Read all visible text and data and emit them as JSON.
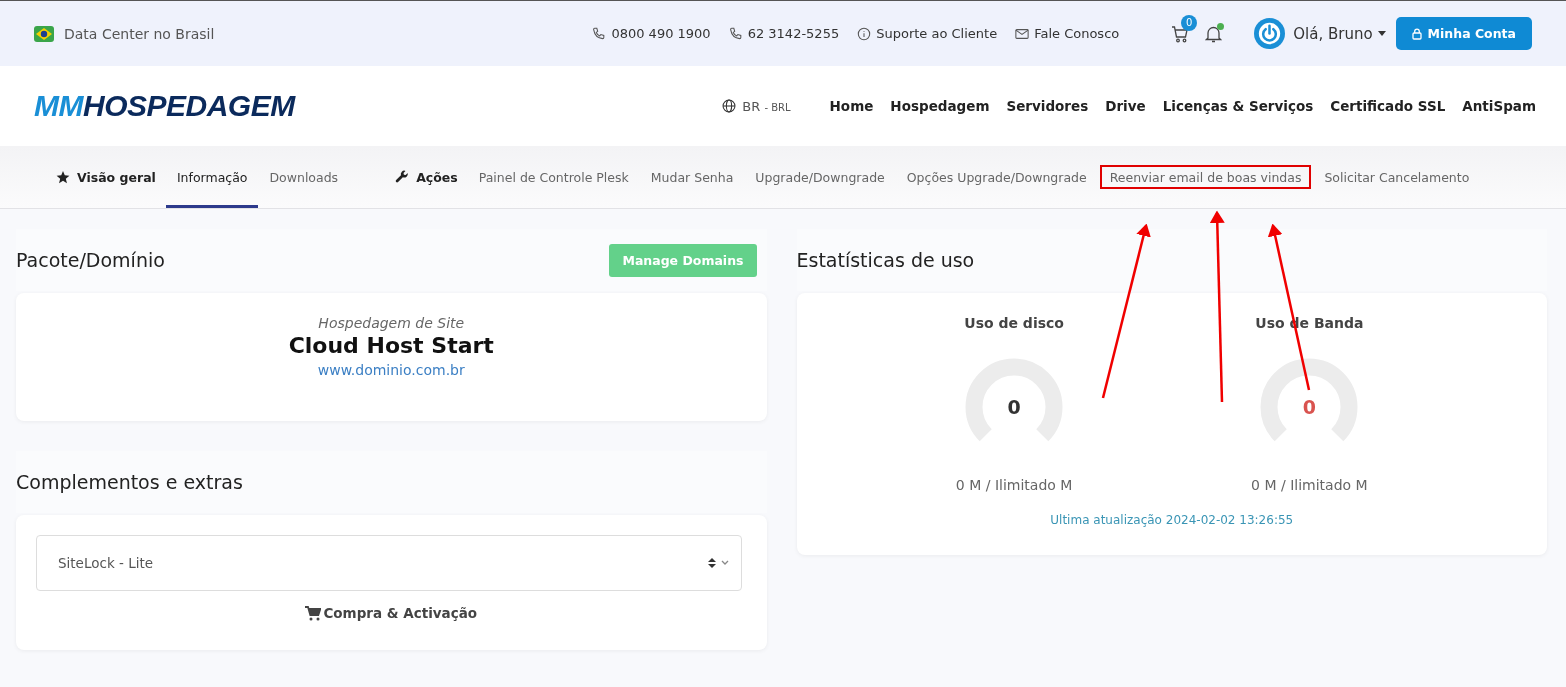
{
  "top_bar": {
    "location": "Data Center no Brasil",
    "links": [
      {
        "kind": "phone",
        "label": "0800 490 1900"
      },
      {
        "kind": "phone",
        "label": "62 3142-5255"
      },
      {
        "kind": "info",
        "label": "Suporte ao Cliente"
      },
      {
        "kind": "mail",
        "label": "Fale Conosco"
      }
    ],
    "cart_count": "0",
    "notification_dot": true,
    "user": "Olá, Bruno",
    "account_button": "Minha Conta"
  },
  "nav": {
    "logo_first": "MM",
    "logo_second": "HOSPEDAGEM",
    "region": "BR",
    "currency": "- BRL",
    "items": [
      "Home",
      "Hospedagem",
      "Servidores",
      "Drive",
      "Licenças & Serviços",
      "Certificado SSL",
      "AntiSpam"
    ]
  },
  "subtabs": [
    {
      "kind": "heading",
      "label": "Visão geral"
    },
    {
      "kind": "tab",
      "label": "Informação",
      "selected": true,
      "highlighted": false
    },
    {
      "kind": "tab",
      "label": "Downloads",
      "selected": false,
      "highlighted": false
    },
    {
      "kind": "heading",
      "label": "Ações"
    },
    {
      "kind": "tab",
      "label": "Painel de Controle Plesk",
      "selected": false,
      "highlighted": false
    },
    {
      "kind": "tab",
      "label": "Mudar Senha",
      "selected": false,
      "highlighted": false
    },
    {
      "kind": "tab",
      "label": "Upgrade/Downgrade",
      "selected": false,
      "highlighted": false
    },
    {
      "kind": "tab",
      "label": "Opções Upgrade/Downgrade",
      "selected": false,
      "highlighted": false
    },
    {
      "kind": "tab",
      "label": "Reenviar email de boas vindas",
      "selected": false,
      "highlighted": true
    },
    {
      "kind": "tab",
      "label": "Solicitar Cancelamento",
      "selected": false,
      "highlighted": false
    }
  ],
  "package": {
    "title": "Pacote/Domínio",
    "button": "Manage Domains",
    "category": "Hospedagem de Site",
    "product": "Cloud Host Start",
    "domain": "www.dominio.com.br"
  },
  "addons": {
    "title": "Complementos e extras",
    "select_value": "SiteLock - Lite",
    "action": "Compra & Activação"
  },
  "stats": {
    "title": "Estatísticas de uso",
    "gauges": [
      {
        "title": "Uso de disco",
        "value": "0",
        "color": "#333333",
        "reading": "0 M / Ilimitado M"
      },
      {
        "title": "Uso de Banda",
        "value": "0",
        "color": "#d9534f",
        "reading": "0 M / Ilimitado M"
      }
    ],
    "updated": "Ultima atualização 2024-02-02 13:26:55"
  }
}
